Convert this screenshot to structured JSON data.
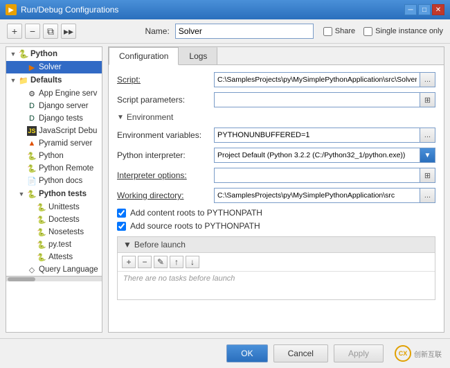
{
  "titlebar": {
    "icon": "▶",
    "title": "Run/Debug Configurations",
    "minimize": "─",
    "maximize": "□",
    "close": "✕"
  },
  "toolbar": {
    "add": "+",
    "remove": "−",
    "copy": "⧉",
    "more": "▸▸",
    "name_label": "Name:",
    "name_value": "Solver",
    "share_label": "Share",
    "single_instance_label": "Single instance only"
  },
  "tree": {
    "items": [
      {
        "id": "python-root",
        "label": "Python",
        "level": 0,
        "expand": "▼",
        "icon": "🐍",
        "type": "group"
      },
      {
        "id": "solver",
        "label": "Solver",
        "level": 1,
        "icon": "▶",
        "selected": true
      },
      {
        "id": "defaults",
        "label": "Defaults",
        "level": 0,
        "expand": "▼",
        "type": "group"
      },
      {
        "id": "app-engine",
        "label": "App Engine serv",
        "level": 1,
        "icon": "⚙"
      },
      {
        "id": "django-server",
        "label": "Django server",
        "level": 1,
        "icon": "D"
      },
      {
        "id": "django-tests",
        "label": "Django tests",
        "level": 1,
        "icon": "D"
      },
      {
        "id": "javascript-debug",
        "label": "JavaScript Debu",
        "level": 1,
        "icon": "JS"
      },
      {
        "id": "pyramid-server",
        "label": "Pyramid server",
        "level": 1,
        "icon": "▲"
      },
      {
        "id": "python",
        "label": "Python",
        "level": 1,
        "icon": "🐍"
      },
      {
        "id": "python-remote",
        "label": "Python Remote",
        "level": 1,
        "icon": "🐍"
      },
      {
        "id": "python-docs",
        "label": "Python docs",
        "level": 1,
        "icon": "📄"
      },
      {
        "id": "python-tests",
        "label": "Python tests",
        "level": 1,
        "expand": "▼",
        "type": "group"
      },
      {
        "id": "unittests",
        "label": "Unittests",
        "level": 2,
        "icon": "🐍"
      },
      {
        "id": "doctests",
        "label": "Doctests",
        "level": 2,
        "icon": "🐍"
      },
      {
        "id": "nosetests",
        "label": "Nosetests",
        "level": 2,
        "icon": "🐍"
      },
      {
        "id": "pytest",
        "label": "py.test",
        "level": 2,
        "icon": "🐍"
      },
      {
        "id": "attests",
        "label": "Attests",
        "level": 2,
        "icon": "🐍"
      },
      {
        "id": "query-language",
        "label": "Query Language",
        "level": 1,
        "icon": "◇"
      }
    ]
  },
  "tabs": [
    {
      "id": "configuration",
      "label": "Configuration",
      "active": true
    },
    {
      "id": "logs",
      "label": "Logs",
      "active": false
    }
  ],
  "form": {
    "script_label": "Script:",
    "script_value": "C:\\SamplesProjects\\py\\MySimplePythonApplication\\src\\Solver.",
    "script_btn": "...",
    "script_params_label": "Script parameters:",
    "script_params_value": "",
    "environment_header": "Environment",
    "env_vars_label": "Environment variables:",
    "env_vars_value": "PYTHONUNBUFFERED=1",
    "env_vars_btn": "...",
    "python_interp_label": "Python interpreter:",
    "python_interp_value": "Project Default (Python 3.2.2 (C:/Python32_1/python.exe))",
    "python_interp_btn": "▼",
    "interp_options_label": "Interpreter options:",
    "interp_options_value": "",
    "interp_options_btn": "⊞",
    "working_dir_label": "Working directory:",
    "working_dir_value": "C:\\SamplesProjects\\py\\MySimplePythonApplication\\src",
    "working_dir_btn": "...",
    "add_content_roots_label": "Add content roots to PYTHONPATH",
    "add_source_roots_label": "Add source roots to PYTHONPATH",
    "before_launch_header": "Before launch",
    "before_launch_hint": "There are no tasks before launch"
  },
  "before_launch_toolbar": {
    "add": "+",
    "remove": "−",
    "edit": "✎",
    "up": "↑",
    "down": "↓"
  },
  "bottom_buttons": {
    "ok": "OK",
    "cancel": "Cancel",
    "apply": "Apply"
  },
  "watermark": {
    "symbol": "创新互联",
    "logo": "CX"
  }
}
